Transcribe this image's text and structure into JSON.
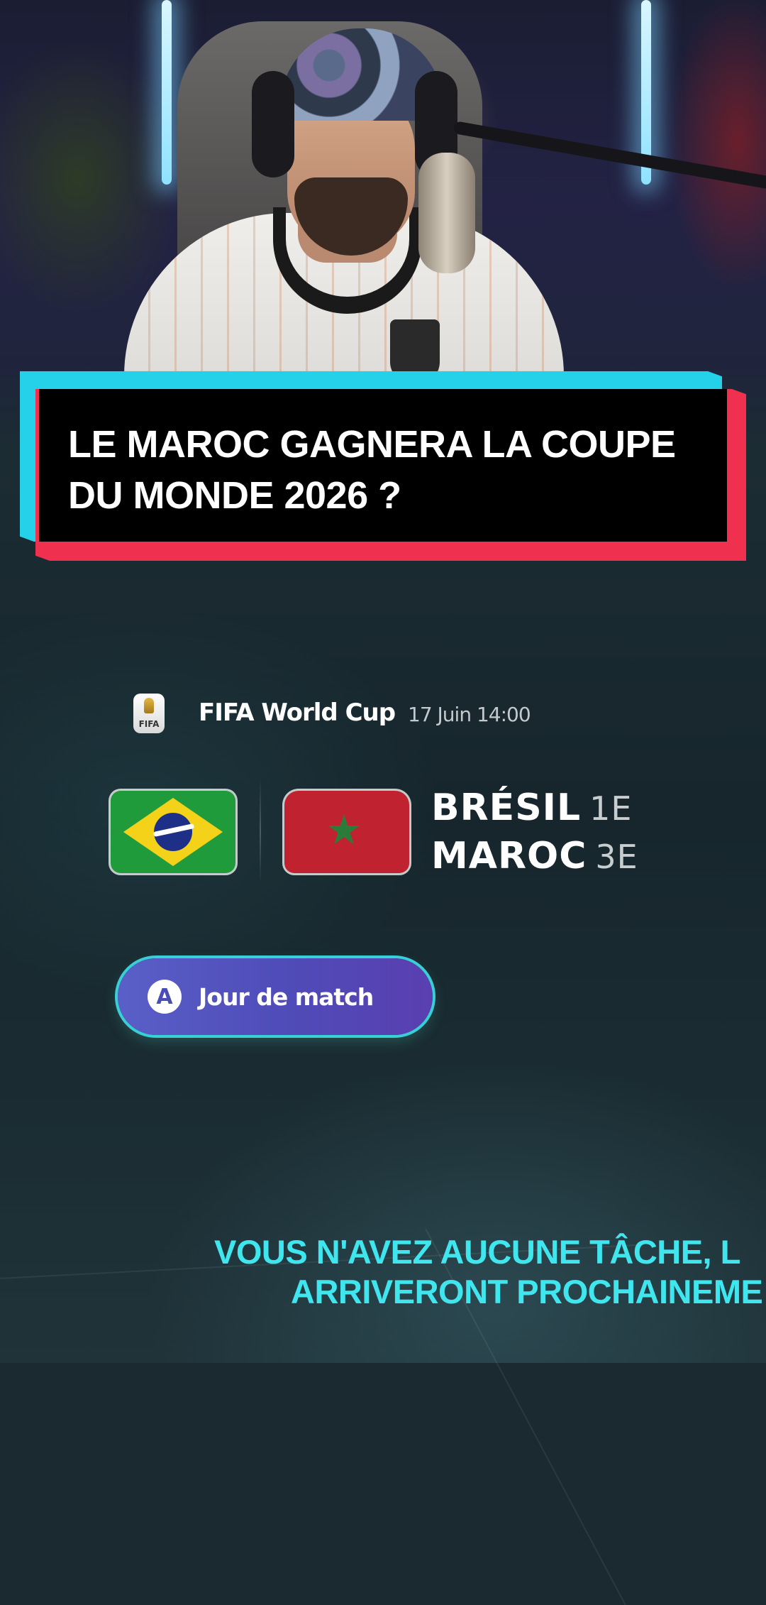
{
  "overlay": {
    "question_line1": "LE MAROC GAGNERA LA COUPE",
    "question_line2": "DU MONDE 2026 ?",
    "colors": {
      "cyan": "#25d1e8",
      "red": "#f0304f",
      "black": "#000000"
    }
  },
  "match": {
    "competition": "FIFA World Cup",
    "competition_logo_text": "FIFA",
    "date": "17 Juin 14:00",
    "home": {
      "name": "BRÉSIL",
      "rank": "1E",
      "flag": "brazil-flag-icon"
    },
    "away": {
      "name": "MAROC",
      "rank": "3E",
      "flag": "morocco-flag-icon"
    },
    "morocco_star": "★"
  },
  "cta": {
    "key": "A",
    "label": "Jour de match",
    "color": "#5a5fc8",
    "border": "#38cfd6"
  },
  "notice": {
    "line1": "VOUS N'AVEZ AUCUNE TÂCHE, L",
    "line2": "ARRIVERONT PROCHAINEME",
    "color": "#3fe6ee"
  }
}
